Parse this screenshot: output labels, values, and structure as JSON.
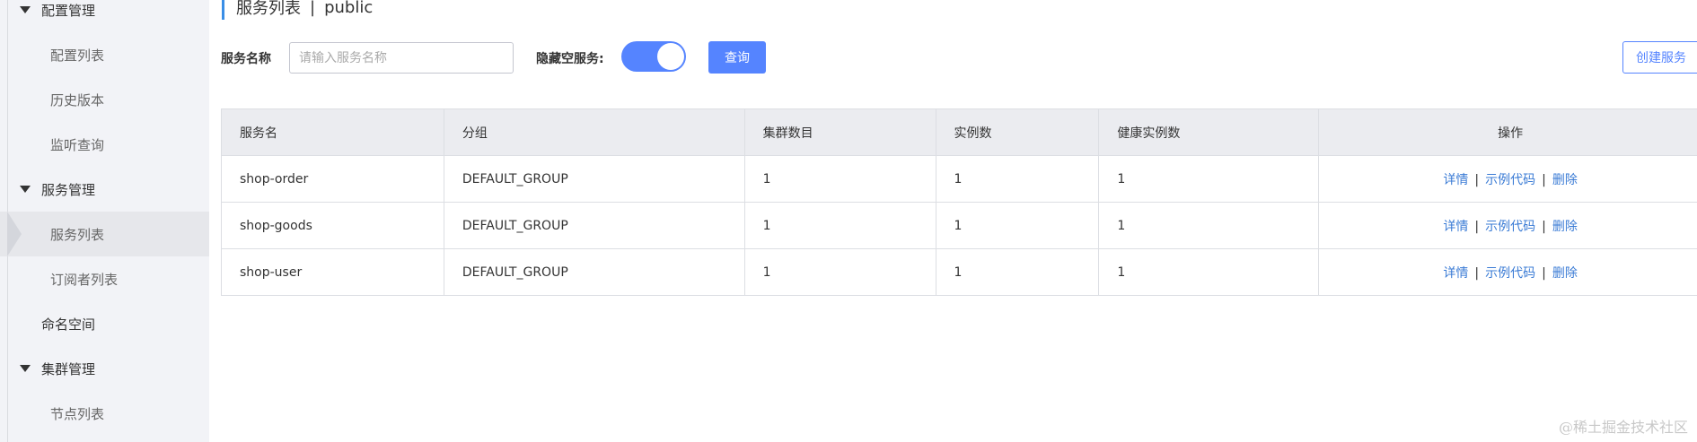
{
  "sidebar": {
    "items": [
      {
        "label": "配置管理",
        "type": "group",
        "expanded": true
      },
      {
        "label": "配置列表",
        "type": "sub"
      },
      {
        "label": "历史版本",
        "type": "sub"
      },
      {
        "label": "监听查询",
        "type": "sub"
      },
      {
        "label": "服务管理",
        "type": "group",
        "expanded": true
      },
      {
        "label": "服务列表",
        "type": "sub",
        "active": true
      },
      {
        "label": "订阅者列表",
        "type": "sub"
      },
      {
        "label": "命名空间",
        "type": "group",
        "expanded": false
      },
      {
        "label": "集群管理",
        "type": "group",
        "expanded": true
      },
      {
        "label": "节点列表",
        "type": "sub"
      }
    ]
  },
  "header": {
    "title": "服务列表",
    "separator": "|",
    "namespace": "public"
  },
  "filters": {
    "service_name_label": "服务名称",
    "service_name_placeholder": "请输入服务名称",
    "service_name_value": "",
    "hide_empty_label": "隐藏空服务:",
    "hide_empty_on": true,
    "query_label": "查询",
    "create_label": "创建服务"
  },
  "table": {
    "columns": [
      "服务名",
      "分组",
      "集群数目",
      "实例数",
      "健康实例数",
      "操作"
    ],
    "rows": [
      {
        "name": "shop-order",
        "group": "DEFAULT_GROUP",
        "clusters": "1",
        "instances": "1",
        "healthy": "1"
      },
      {
        "name": "shop-goods",
        "group": "DEFAULT_GROUP",
        "clusters": "1",
        "instances": "1",
        "healthy": "1"
      },
      {
        "name": "shop-user",
        "group": "DEFAULT_GROUP",
        "clusters": "1",
        "instances": "1",
        "healthy": "1"
      }
    ],
    "actions": {
      "detail": "详情",
      "sample_code": "示例代码",
      "delete": "删除",
      "separator": "|"
    }
  },
  "watermark": "@稀土掘金技术社区",
  "colors": {
    "primary": "#5584ff",
    "link": "#3a7bd5",
    "accent_bar": "#3a8ee6",
    "sidebar_bg": "#f2f3f7",
    "header_bg": "#ebecf0"
  }
}
